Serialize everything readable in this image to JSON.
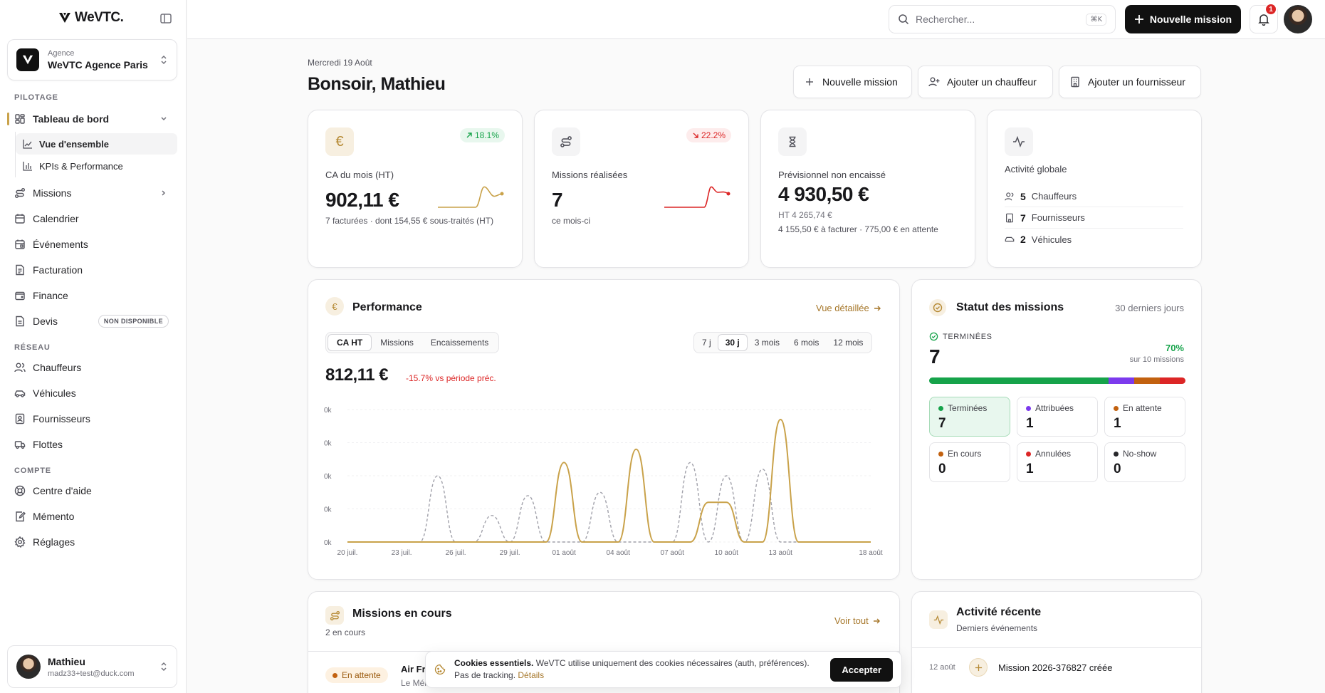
{
  "app": {
    "brand": "WeVTC."
  },
  "agency": {
    "label": "Agence",
    "name": "WeVTC Agence Paris"
  },
  "nav": {
    "pilotage_label": "PILOTAGE",
    "dashboard": "Tableau de bord",
    "sub": [
      "Vue d'ensemble",
      "KPIs & Performance"
    ],
    "items_a": [
      "Missions",
      "Calendrier",
      "Événements",
      "Facturation",
      "Finance",
      "Devis"
    ],
    "devis_badge": "NON DISPONIBLE",
    "reseau_label": "RÉSEAU",
    "items_b": [
      "Chauffeurs",
      "Véhicules",
      "Fournisseurs",
      "Flottes"
    ],
    "compte_label": "COMPTE",
    "items_c": [
      "Centre d'aide",
      "Mémento",
      "Réglages"
    ]
  },
  "user": {
    "name": "Mathieu",
    "email": "madz33+test@duck.com"
  },
  "topbar": {
    "search_placeholder": "Rechercher...",
    "search_kbd": "⌘K",
    "new_mission": "Nouvelle mission",
    "notif_count": "1"
  },
  "header": {
    "date": "Mercredi 19 Août",
    "greeting": "Bonsoir, Mathieu",
    "actions": [
      "Nouvelle mission",
      "Ajouter un chauffeur",
      "Ajouter un fournisseur"
    ]
  },
  "kpis": {
    "ca": {
      "label": "CA du mois (HT)",
      "value": "902,11 €",
      "sub": "7 facturées · dont 154,55 € sous-traités (HT)",
      "trend": "18.1%"
    },
    "missions": {
      "label": "Missions réalisées",
      "value": "7",
      "sub": "ce mois-ci",
      "trend": "22.2%"
    },
    "prev": {
      "label": "Prévisionnel non encaissé",
      "value": "4 930,50 €",
      "sub1": "HT 4 265,74 €",
      "sub2": "4 155,50 € à facturer · 775,00 € en attente"
    },
    "activity": {
      "label": "Activité globale",
      "rows": [
        {
          "count": "5",
          "label": "Chauffeurs"
        },
        {
          "count": "7",
          "label": "Fournisseurs"
        },
        {
          "count": "2",
          "label": "Véhicules"
        }
      ]
    }
  },
  "performance": {
    "title": "Performance",
    "link": "Vue détaillée",
    "metric_tabs": [
      "CA HT",
      "Missions",
      "Encaissements"
    ],
    "period_tabs": [
      "7 j",
      "30 j",
      "3 mois",
      "6 mois",
      "12 mois"
    ],
    "value": "812,11 €",
    "delta": "-15.7% vs période préc."
  },
  "chart_data": {
    "type": "line",
    "x": [
      "20 juil.",
      "21 juil.",
      "22 juil.",
      "23 juil.",
      "24 juil.",
      "25 juil.",
      "26 juil.",
      "27 juil.",
      "28 juil.",
      "29 juil.",
      "30 juil.",
      "31 juil.",
      "01 août",
      "02 août",
      "03 août",
      "04 août",
      "05 août",
      "06 août",
      "07 août",
      "08 août",
      "09 août",
      "10 août",
      "11 août",
      "12 août",
      "13 août",
      "14 août",
      "15 août",
      "16 août",
      "17 août",
      "18 août"
    ],
    "x_ticks": [
      "20 juil.",
      "23 juil.",
      "26 juil.",
      "29 juil.",
      "01 août",
      "04 août",
      "07 août",
      "10 août",
      "13 août",
      "18 août"
    ],
    "y_ticks": [
      "0k",
      "0k",
      "0k",
      "0k",
      "0k"
    ],
    "ylim": [
      0,
      0.4
    ],
    "series": [
      {
        "style": "solid",
        "color": "#c9a24a",
        "values": [
          0,
          0,
          0,
          0,
          0,
          0,
          0,
          0,
          0,
          0,
          0,
          0,
          0.24,
          0,
          0,
          0,
          0.28,
          0,
          0,
          0,
          0.12,
          0.12,
          0,
          0,
          0.37,
          0,
          0,
          0,
          0,
          0
        ]
      },
      {
        "style": "dashed",
        "color": "#a1a1aa",
        "values": [
          0,
          0,
          0,
          0,
          0,
          0.2,
          0,
          0,
          0.08,
          0,
          0.14,
          0,
          0,
          0,
          0.15,
          0,
          0,
          0,
          0,
          0.24,
          0,
          0.2,
          0,
          0.22,
          0,
          0,
          0,
          0,
          0,
          0
        ]
      }
    ]
  },
  "status": {
    "title": "Statut des missions",
    "period": "30 derniers jours",
    "done_label": "TERMINÉES",
    "done_count": "7",
    "pct": "70%",
    "of_total": "sur 10 missions",
    "bar": [
      {
        "value": 7,
        "color": "#16a34a"
      },
      {
        "value": 1,
        "color": "#7c3aed"
      },
      {
        "value": 1,
        "color": "#c2610f"
      },
      {
        "value": 1,
        "color": "#dc2626"
      }
    ],
    "boxes": [
      {
        "label": "Terminées",
        "count": "7",
        "color": "#16a34a"
      },
      {
        "label": "Attribuées",
        "count": "1",
        "color": "#7c3aed"
      },
      {
        "label": "En attente",
        "count": "1",
        "color": "#c2610f"
      },
      {
        "label": "En cours",
        "count": "0",
        "color": "#c2610f"
      },
      {
        "label": "Annulées",
        "count": "1",
        "color": "#dc2626"
      },
      {
        "label": "No-show",
        "count": "0",
        "color": "#27272a"
      }
    ]
  },
  "ongoing": {
    "title": "Missions en cours",
    "count": "2 en cours",
    "link": "Voir tout",
    "row": {
      "badge": "En attente",
      "title": "Air Fr",
      "sub": "Le Méi"
    }
  },
  "recent": {
    "title": "Activité récente",
    "sub": "Derniers événements",
    "item": {
      "date": "12 août",
      "text": "Mission 2026-376827 créée"
    }
  },
  "cookie": {
    "title": "Cookies essentiels.",
    "text": "WeVTC utilise uniquement des cookies nécessaires (auth, préférences). Pas de tracking.",
    "link": "Détails",
    "accept": "Accepter"
  }
}
